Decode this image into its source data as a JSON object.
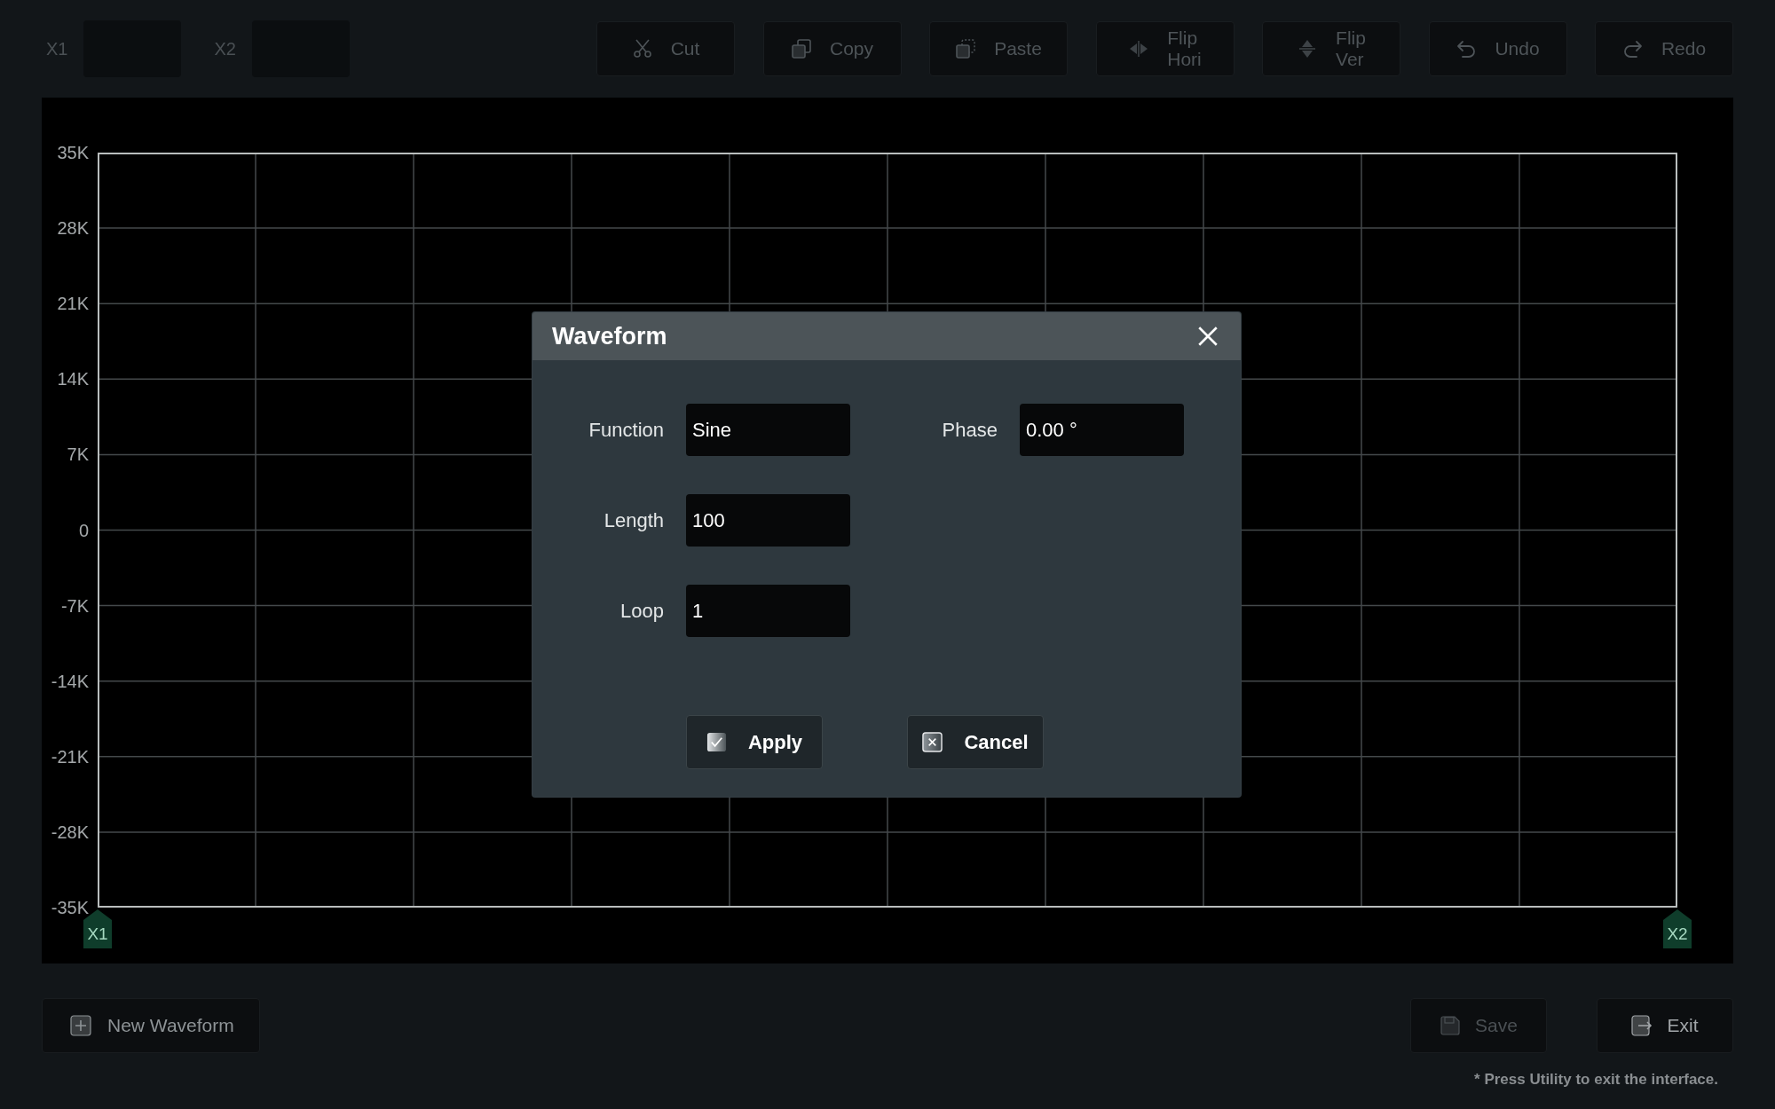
{
  "cursor_fields": [
    {
      "label": "X1"
    },
    {
      "label": "X2"
    }
  ],
  "toolbar": [
    {
      "label": "Cut",
      "kind": "cut",
      "disabled": true
    },
    {
      "label": "Copy",
      "kind": "copy",
      "disabled": true
    },
    {
      "label": "Paste",
      "kind": "paste",
      "disabled": true
    },
    {
      "label": "Flip Hori",
      "kind": "flip-horizontal",
      "disabled": true
    },
    {
      "label": "Flip Ver",
      "kind": "flip-vertical",
      "disabled": true
    },
    {
      "label": "Undo",
      "kind": "undo",
      "disabled": true
    },
    {
      "label": "Redo",
      "kind": "redo",
      "disabled": true
    }
  ],
  "chart": {
    "chart_data": {
      "type": "line",
      "grid": true,
      "categories": [
        null,
        null,
        null,
        null,
        null,
        null,
        null,
        null,
        null,
        null,
        null
      ],
      "ylim": [
        -35000,
        35000
      ],
      "yticks": [
        {
          "value": 35000,
          "label": "35K"
        },
        {
          "value": 28000,
          "label": "28K"
        },
        {
          "value": 21000,
          "label": "21K"
        },
        {
          "value": 14000,
          "label": "14K"
        },
        {
          "value": 7000,
          "label": "7K"
        },
        {
          "value": 0,
          "label": "0"
        },
        {
          "value": -7000,
          "label": "-7K"
        },
        {
          "value": -14000,
          "label": "-14K"
        },
        {
          "value": -21000,
          "label": "-21K"
        },
        {
          "value": -28000,
          "label": "-28K"
        },
        {
          "value": -35000,
          "label": "-35K"
        }
      ]
    },
    "cursors": [
      {
        "label": "X1"
      },
      {
        "label": "X2"
      }
    ]
  },
  "dialog": {
    "title": "Waveform",
    "field_columns": [
      {
        "fields": [
          {
            "label": "Function",
            "value": "Sine"
          },
          {
            "label": "Length",
            "value": "100"
          },
          {
            "label": "Loop",
            "value": "1"
          }
        ]
      },
      {
        "fields": [
          {
            "label": "Phase",
            "value": "0.00 °"
          }
        ]
      }
    ],
    "buttons": [
      {
        "label": "Apply",
        "kind": "apply"
      },
      {
        "label": "Cancel",
        "kind": "cancel"
      }
    ]
  },
  "bottom_bar": {
    "left_buttons": [
      {
        "label": "New Waveform",
        "kind": "new",
        "disabled": false
      }
    ],
    "right_buttons": [
      {
        "label": "Save",
        "kind": "save",
        "disabled": true
      },
      {
        "label": "Exit",
        "kind": "exit",
        "disabled": false
      }
    ],
    "note": "* Press Utility to exit the interface."
  }
}
